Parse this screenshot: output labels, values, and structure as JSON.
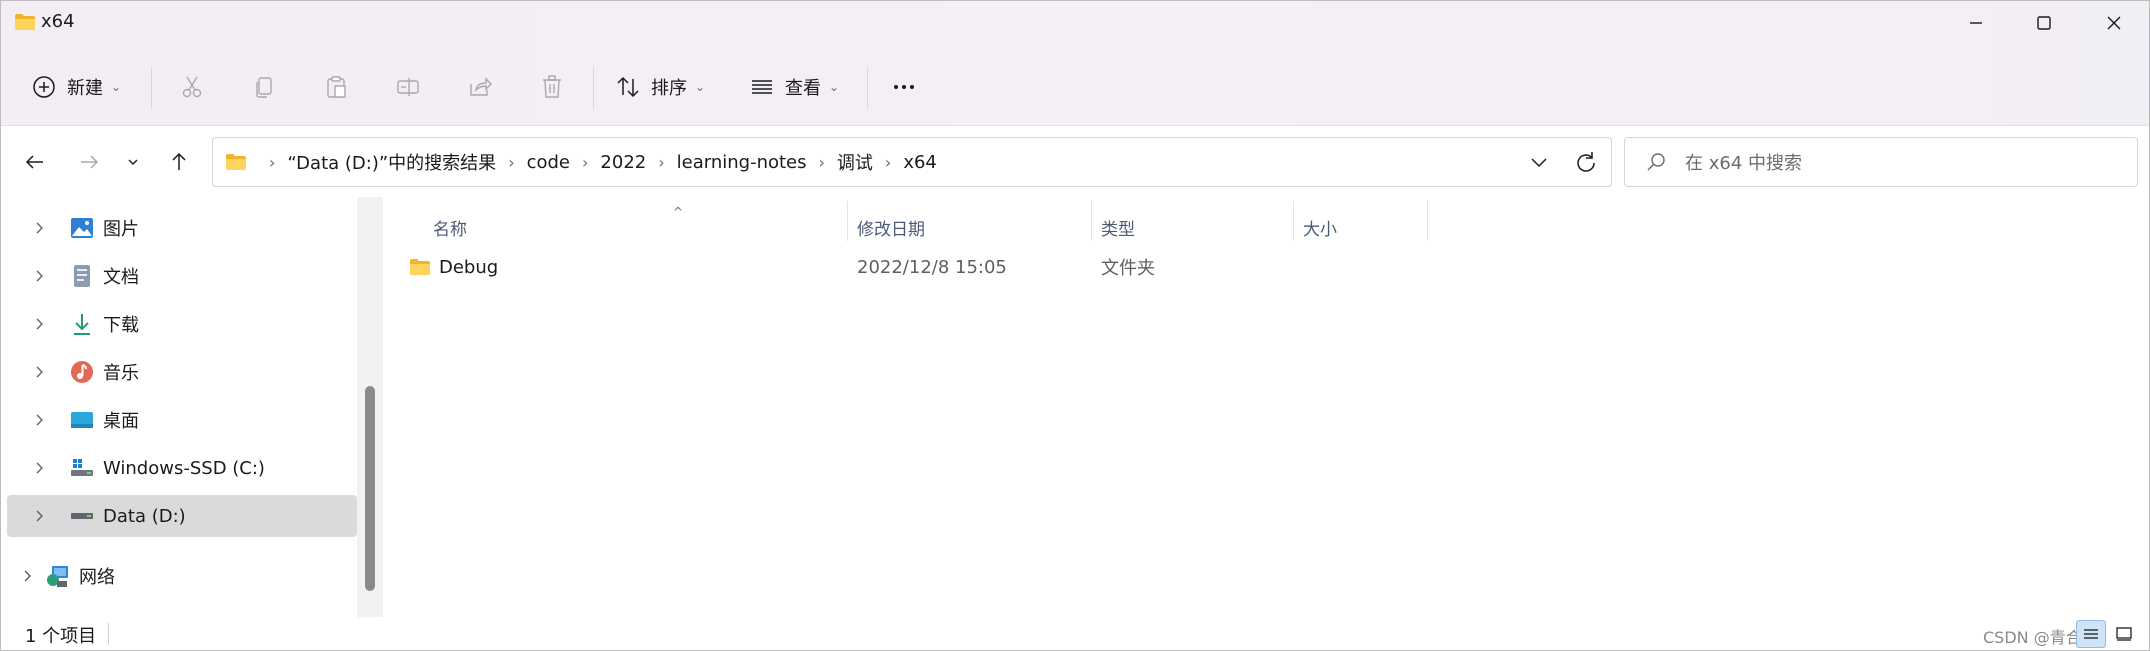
{
  "window": {
    "title": "x64",
    "controls": [
      "minimize",
      "maximize",
      "close"
    ]
  },
  "toolbar": {
    "new_label": "新建",
    "sort_label": "排序",
    "view_label": "查看",
    "icons": [
      "plus-circle-icon",
      "cut-icon",
      "copy-icon",
      "paste-icon",
      "rename-icon",
      "share-icon",
      "delete-icon",
      "sort-icon",
      "view-icon",
      "more-icon"
    ]
  },
  "navigation": {
    "breadcrumbs": [
      "“Data (D:)”中的搜索结果",
      "code",
      "2022",
      "learning-notes",
      "调试",
      "x64"
    ],
    "search_placeholder": "在 x64 中搜索"
  },
  "sidebar": {
    "items": [
      {
        "label": "图片",
        "icon": "pictures-icon"
      },
      {
        "label": "文档",
        "icon": "documents-icon"
      },
      {
        "label": "下载",
        "icon": "downloads-icon"
      },
      {
        "label": "音乐",
        "icon": "music-icon"
      },
      {
        "label": "桌面",
        "icon": "desktop-icon"
      },
      {
        "label": "Windows-SSD (C:)",
        "icon": "system-drive-icon"
      },
      {
        "label": "Data (D:)",
        "icon": "drive-icon",
        "selected": true
      },
      {
        "label": "网络",
        "icon": "network-icon"
      }
    ]
  },
  "content": {
    "columns": [
      "名称",
      "修改日期",
      "类型",
      "大小"
    ],
    "sort_column": "名称",
    "rows": [
      {
        "name": "Debug",
        "modified": "2022/12/8 15:05",
        "type": "文件夹",
        "size": ""
      }
    ]
  },
  "status": {
    "item_count": "1 个项目",
    "watermark": "CSDN @青合志"
  },
  "colors": {
    "folder": "#F7C640",
    "selected_bg": "#DADADA",
    "header_text": "#4A5A78"
  }
}
